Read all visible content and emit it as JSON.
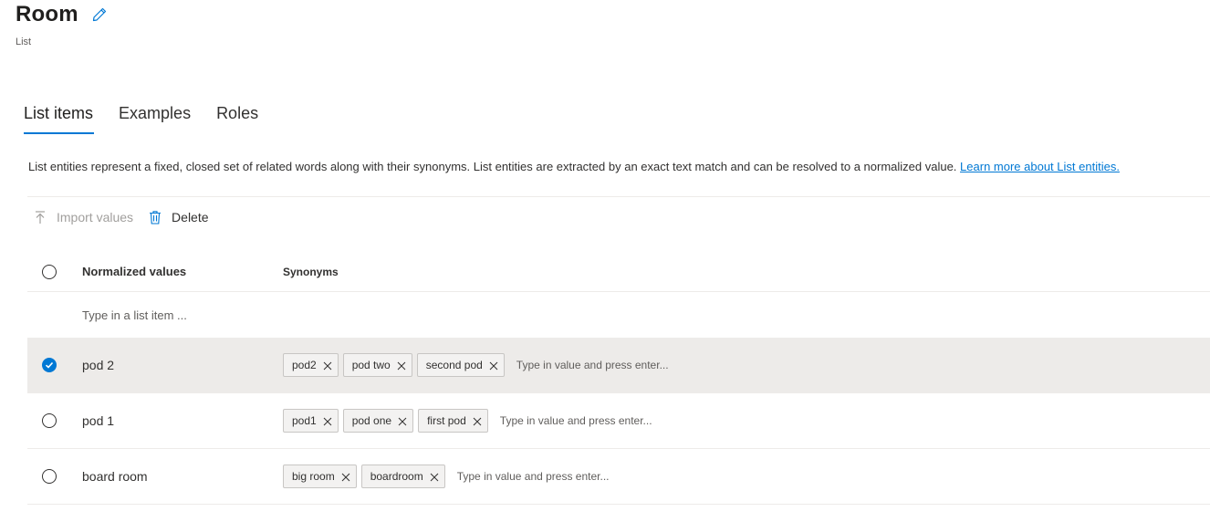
{
  "header": {
    "title": "Room",
    "subtitle": "List"
  },
  "tabs": [
    {
      "label": "List items",
      "active": true
    },
    {
      "label": "Examples",
      "active": false
    },
    {
      "label": "Roles",
      "active": false
    }
  ],
  "description": {
    "text": "List entities represent a fixed, closed set of related words along with their synonyms. List entities are extracted by an exact text match and can be resolved to a normalized value. ",
    "link": "Learn more about List entities."
  },
  "toolbar": {
    "import_label": "Import values",
    "delete_label": "Delete"
  },
  "table": {
    "headers": {
      "normalized": "Normalized values",
      "synonyms": "Synonyms"
    },
    "new_item_placeholder": "Type in a list item ...",
    "synonym_placeholder": "Type in value and press enter...",
    "rows": [
      {
        "value": "pod 2",
        "selected": true,
        "synonyms": [
          "pod2",
          "pod two",
          "second pod"
        ]
      },
      {
        "value": "pod 1",
        "selected": false,
        "synonyms": [
          "pod1",
          "pod one",
          "first pod"
        ]
      },
      {
        "value": "board room",
        "selected": false,
        "synonyms": [
          "big room",
          "boardroom"
        ]
      }
    ]
  },
  "colors": {
    "accent": "#0078d4",
    "selected_row_bg": "#edebe9",
    "chip_bg": "#f3f2f1"
  }
}
